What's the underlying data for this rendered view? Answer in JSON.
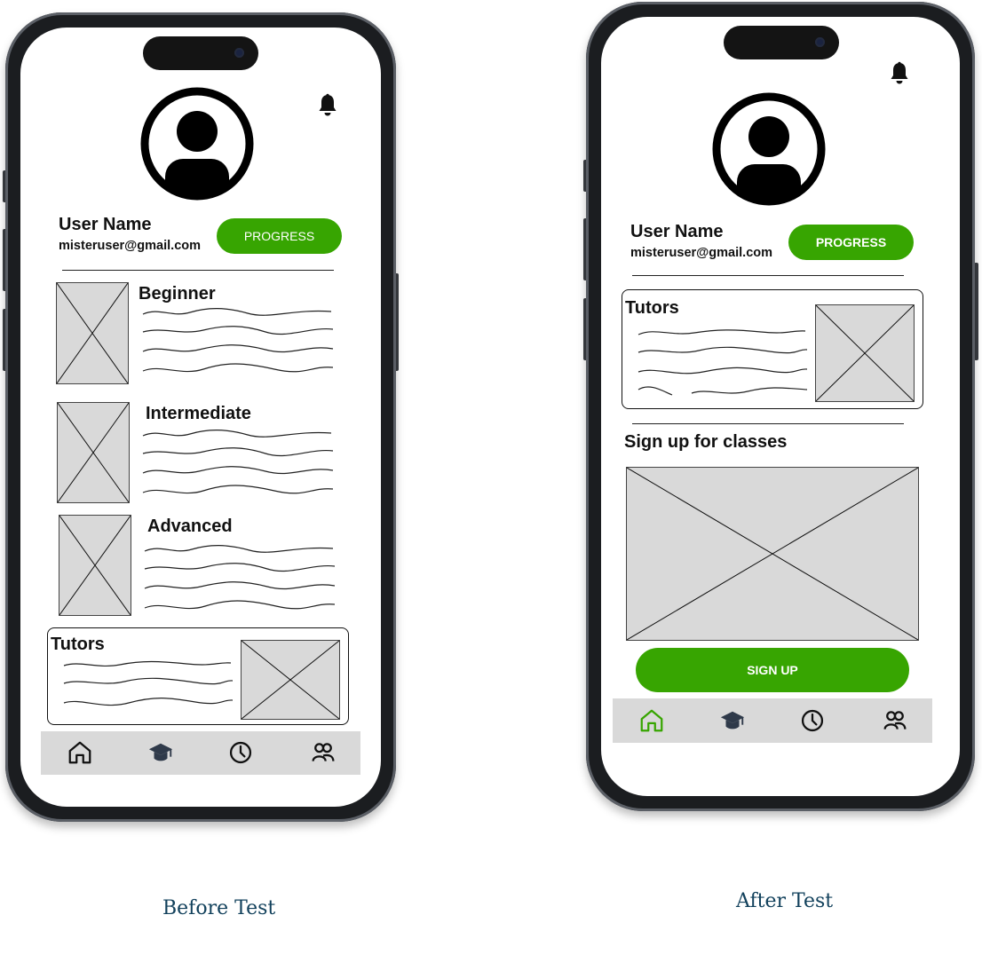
{
  "before": {
    "user_name": "User Name",
    "email": "misteruser@gmail.com",
    "progress_label": "PROGRESS",
    "levels": [
      {
        "title": "Beginner"
      },
      {
        "title": "Intermediate"
      },
      {
        "title": "Advanced"
      }
    ],
    "tutors_title": "Tutors",
    "nav": [
      "home-icon",
      "graduation-cap-icon",
      "clock-icon",
      "users-icon"
    ],
    "caption": "Before Test"
  },
  "after": {
    "user_name": "User Name",
    "email": "misteruser@gmail.com",
    "progress_label": "PROGRESS",
    "tutors_title": "Tutors",
    "signup_heading": "Sign up for classes",
    "signup_label": "SIGN UP",
    "nav": [
      "home-icon",
      "graduation-cap-icon",
      "clock-icon",
      "users-icon"
    ],
    "active_nav": "home-icon",
    "caption": "After Test"
  },
  "colors": {
    "accent": "#37a501",
    "placeholder": "#d9d9d9",
    "caption": "#12415c"
  }
}
